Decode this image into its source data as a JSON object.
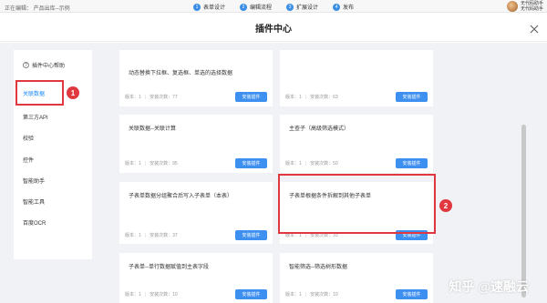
{
  "topbar": {
    "breadcrumb": "正在编辑：  产品出库--示例",
    "steps": [
      {
        "num": "1",
        "label": "表单设计"
      },
      {
        "num": "2",
        "label": "编辑流程"
      },
      {
        "num": "3",
        "label": "扩展设计"
      },
      {
        "num": "4",
        "label": "发布"
      }
    ],
    "user_line1": "无代码助手",
    "user_line2": "无代码助手"
  },
  "modal": {
    "title": "插件中心"
  },
  "sidebar": {
    "help": "插件中心帮助",
    "items": [
      "关联数据",
      "第三方API",
      "校验",
      "控件",
      "智能助手",
      "智能工具",
      "百度OCR"
    ]
  },
  "annotations": {
    "badge1": "1",
    "badge2": "2"
  },
  "cards": [
    {
      "title": "动态替换下拉框、复选框、单选的选择数据",
      "version": "版本：1",
      "installs": "安装次数：77",
      "button": "安装插件"
    },
    {
      "title": "",
      "version": "版本：1",
      "installs": "安装次数：63",
      "button": "安装插件"
    },
    {
      "title": "关联数据--关联计算",
      "version": "版本：1",
      "installs": "安装次数：95",
      "button": "安装插件"
    },
    {
      "title": "主查子（高级筛选模式）",
      "version": "版本：1",
      "installs": "安装次数：50",
      "button": "安装插件"
    },
    {
      "title": "子表单数据分组聚合后写入子表单（本表）",
      "version": "版本：1",
      "installs": "安装次数：37",
      "button": "安装插件"
    },
    {
      "title": "子表单根据条件拆解到其他子表单",
      "version": "版本：1",
      "installs": "安装次数：33",
      "button": "安装插件"
    },
    {
      "title": "子表单--单行数据赋值到主表字段",
      "version": "版本：1",
      "installs": "安装次数：10",
      "button": "安装插件"
    },
    {
      "title": "智能筛选--筛选树形数据",
      "version": "版本：1",
      "installs": "安装次数：10",
      "button": "安装插件"
    }
  ],
  "watermark": {
    "text1": "知乎",
    "text2": "@速融云"
  },
  "colors": {
    "accent": "#3d8ff0",
    "annotation": "#e0383e",
    "active": "#1989fa"
  }
}
